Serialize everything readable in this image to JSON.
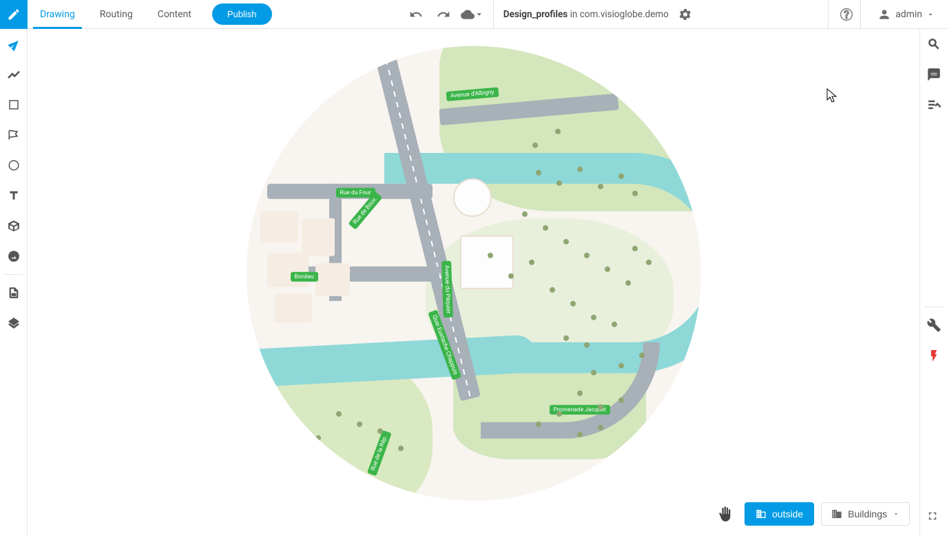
{
  "header": {
    "tabs": {
      "drawing": "Drawing",
      "routing": "Routing",
      "content": "Content"
    },
    "publish": "Publish",
    "project_name": "Design_profiles",
    "project_in": "in",
    "project_domain": "com.visioglobe.demo",
    "user": "admin"
  },
  "map": {
    "labels": {
      "avenue": "Avenue d'Albigny",
      "quai": "Quai Eustache Chappuis",
      "prom": "Promenade Jacquet",
      "four": "Rue du Four",
      "bouv": "Rue de Bouv.",
      "paq": "Avenue du Pâquier",
      "bonl": "Bonlieu",
      "rep": "Rue de la Rép."
    }
  },
  "bottom": {
    "outside": "outside",
    "buildings": "Buildings"
  }
}
